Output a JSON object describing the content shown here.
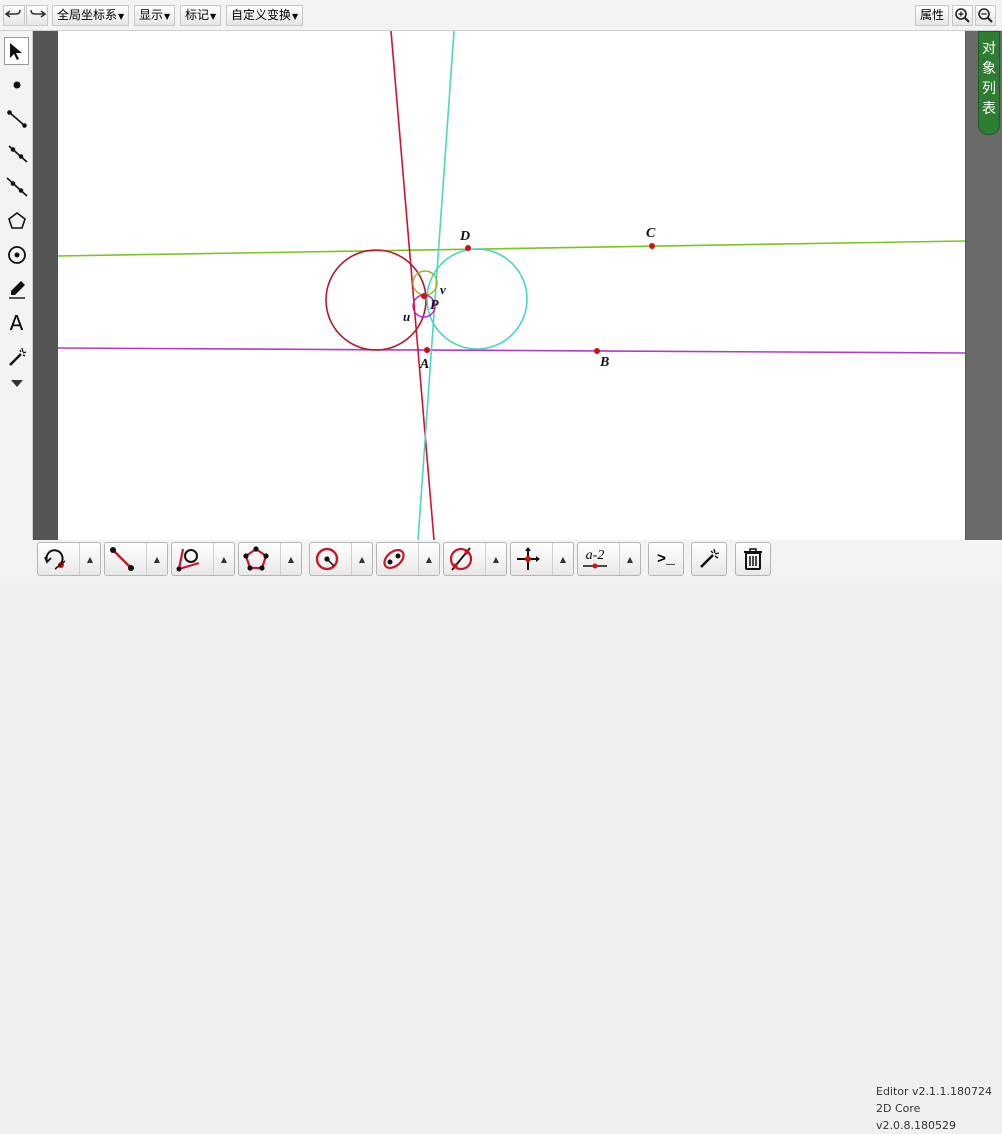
{
  "toolbar": {
    "undo_icon": "undo-icon",
    "redo_icon": "redo-icon",
    "menus": [
      "全局坐标系",
      "显示",
      "标记",
      "自定义变换"
    ],
    "properties_label": "属性",
    "zoom_in_icon": "zoom-in-icon",
    "zoom_out_icon": "zoom-out-icon"
  },
  "left_tools": [
    "select-arrow-icon",
    "point-icon",
    "segment-icon",
    "ray-icon",
    "line-icon",
    "polygon-icon",
    "circle-icon",
    "pen-icon",
    "text-icon",
    "magic-icon",
    "more-icon"
  ],
  "left_text_tool": "A",
  "object_list_tab": [
    "对",
    "象",
    "列",
    "表"
  ],
  "drawing": {
    "points": [
      {
        "label": "A"
      },
      {
        "label": "B"
      },
      {
        "label": "C"
      },
      {
        "label": "D"
      },
      {
        "label": "P"
      }
    ],
    "curve_labels": [
      "u",
      "v"
    ],
    "colors": {
      "line_dc": "#7cc520",
      "line_ab": "#b23cc8",
      "line_red": "#cc1530",
      "line_cyan": "#4fd6c0",
      "circle_red": "#b5182d",
      "circle_cyan": "#49d6c6",
      "small_circle_olive": "#9ab424",
      "small_circle_magenta": "#c21ec8",
      "point": "#d01010"
    }
  },
  "bottom_tools": [
    "rotate-tool-icon",
    "segment-tool-icon",
    "angle-tool-icon",
    "polygon-tool-icon",
    "circle-tool-icon",
    "conic-tool-icon",
    "intersect-tool-icon",
    "transform-tool-icon",
    "measure-tool-icon",
    "command-tool-icon",
    "magic-wand-icon",
    "trash-icon"
  ],
  "measure_label": "a-2",
  "command_label": ">_",
  "version": {
    "editor": "Editor v2.1.1.180724",
    "core": "2D Core v2.0.8.180529"
  }
}
